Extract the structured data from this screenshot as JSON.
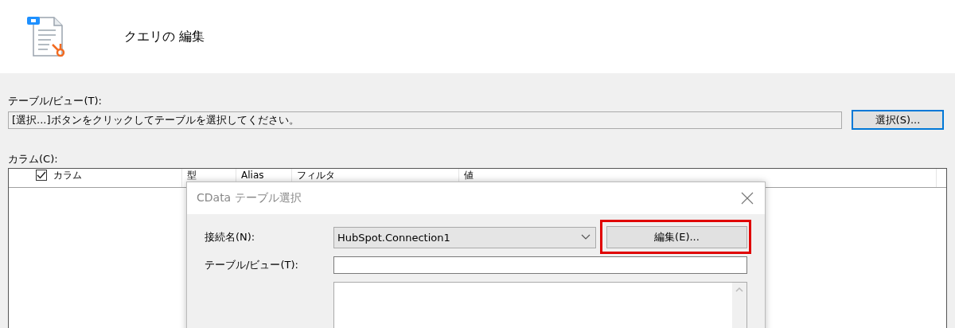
{
  "window": {
    "title": "クエリの 編集"
  },
  "table_view": {
    "label": "テーブル/ビュー(T):",
    "value": "[選択...]ボタンをクリックしてテーブルを選択してください。",
    "button": "選択(S)..."
  },
  "columns": {
    "label": "カラム(C):",
    "select_all_checked": true,
    "headers": [
      "カラム",
      "型",
      "Alias",
      "フィルタ",
      "値"
    ]
  },
  "dialog": {
    "title": "CData テーブル選択",
    "connection_label": "接続名(N):",
    "connection_value": "HubSpot.Connection1",
    "edit_button": "編集(E)...",
    "edit_highlighted": true,
    "table_label": "テーブル/ビュー(T):"
  }
}
